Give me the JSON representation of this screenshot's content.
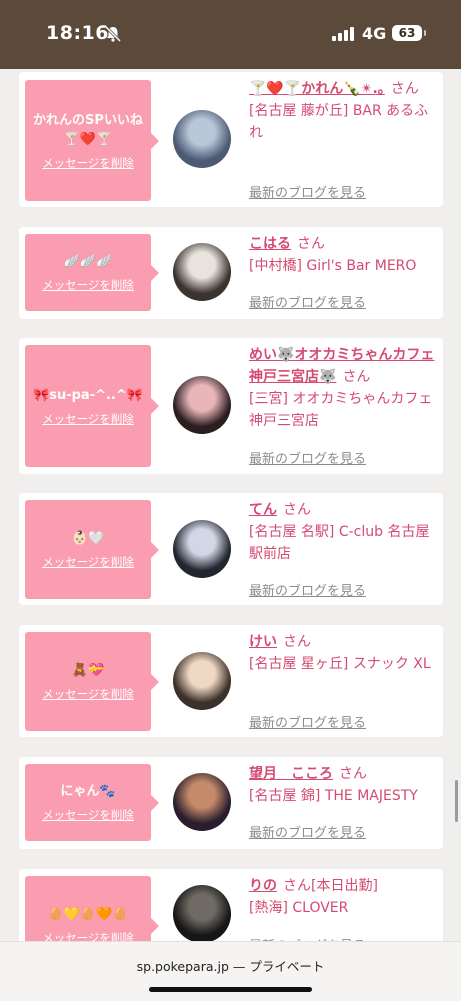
{
  "status": {
    "time": "18:16",
    "network": "4G",
    "battery": "63"
  },
  "browser": {
    "url": "sp.pokepara.jp — プライベート"
  },
  "delete_label": "メッセージを削除",
  "blog_label": "最新のブログを見る",
  "san": "さん",
  "items": [
    {
      "message": "かれんのSPいいね🍸❤️🍸",
      "name": "🍸❤️🍸かれん🍾✴︎.｡",
      "extra": "",
      "shop": "[名古屋 藤が丘] BAR あるふれ",
      "avatar_colors": [
        "#4c5a74",
        "#b9c7d9"
      ]
    },
    {
      "message": "🪽🪽🪽",
      "name": "こはる",
      "extra": "",
      "shop": "[中村橋] Girl's Bar MERO",
      "avatar_colors": [
        "#3a3330",
        "#e9e3de"
      ]
    },
    {
      "message": "🎀su-pa-^..^🎀",
      "name": "めい🐺オオカミちゃんカフェ神戸三宮店🐺",
      "extra": "",
      "shop": "[三宮] オオカミちゃんカフェ神戸三宮店",
      "avatar_colors": [
        "#2b1e20",
        "#e8b6b9"
      ]
    },
    {
      "message": "👶🏻🤍",
      "name": "てん",
      "extra": "",
      "shop": "[名古屋 名駅] C-club 名古屋駅前店",
      "avatar_colors": [
        "#23262f",
        "#d2d7e6"
      ]
    },
    {
      "message": "🧸💝",
      "name": "けい",
      "extra": "",
      "shop": "[名古屋 星ヶ丘] スナック XL",
      "avatar_colors": [
        "#3c302a",
        "#f0d9c4"
      ]
    },
    {
      "message": "にゃん🐾",
      "name": "望月　こころ",
      "extra": "",
      "shop": "[名古屋 錦] THE MAJESTY",
      "avatar_colors": [
        "#2a1e2e",
        "#c58a6a"
      ]
    },
    {
      "message": "🥚💛🥚🧡🥚",
      "name": "りの",
      "extra": "[本日出勤]",
      "shop": "[熱海] CLOVER",
      "avatar_colors": [
        "#161616",
        "#6f6a63"
      ]
    }
  ]
}
